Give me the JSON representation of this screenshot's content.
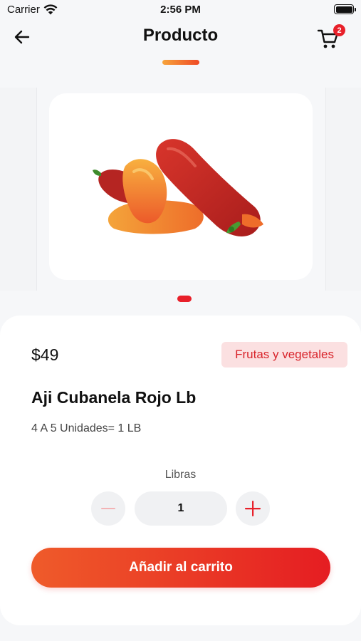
{
  "status_bar": {
    "carrier": "Carrier",
    "time": "2:56 PM"
  },
  "nav": {
    "title": "Producto",
    "cart_count": "2",
    "back_icon": "arrow-left-icon",
    "cart_icon": "shopping-cart-icon"
  },
  "carousel": {
    "active_index": 0,
    "image_subject": "red and orange peppers"
  },
  "product": {
    "price": "$49",
    "category": "Frutas y vegetales",
    "name": "Aji Cubanela Rojo Lb",
    "description": "4 A 5 Unidades= 1 LB"
  },
  "quantity": {
    "unit_label": "Libras",
    "value": "1",
    "minus_icon": "minus-icon",
    "plus_icon": "plus-icon"
  },
  "actions": {
    "add_to_cart": "Añadir al carrito"
  },
  "colors": {
    "accent": "#e8202a",
    "tag_background": "#fbe0e1",
    "button_gradient_start": "#ef5b2a",
    "button_gradient_end": "#e51d22"
  }
}
